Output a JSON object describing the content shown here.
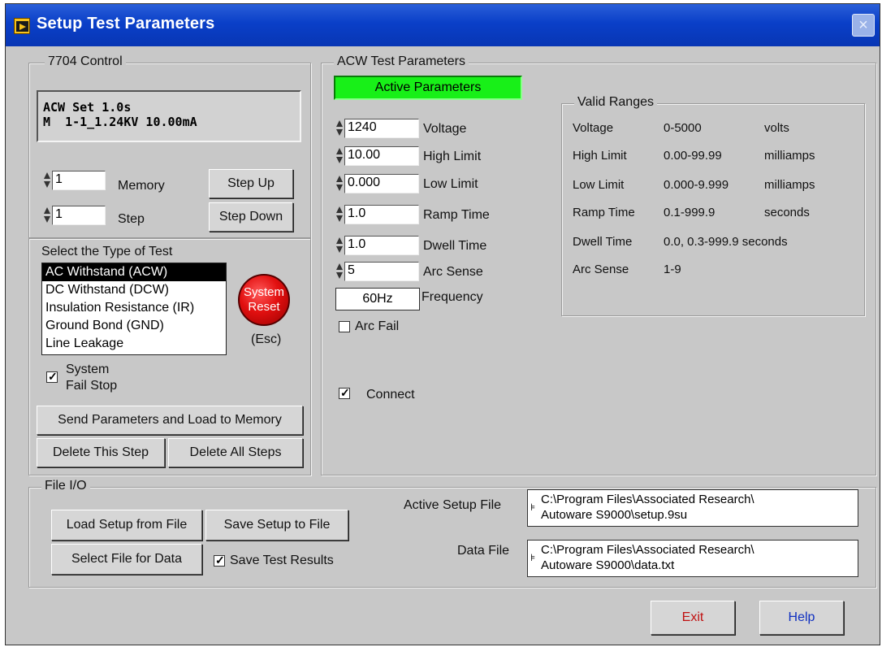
{
  "window": {
    "title": "Setup Test Parameters",
    "close_label": "×"
  },
  "control": {
    "legend": "7704 Control",
    "display_line1": "ACW Set 1.0s",
    "display_line2": "M  1-1_1.24KV 10.00mA",
    "memory_value": "1",
    "memory_label": "Memory",
    "step_value": "1",
    "step_label": "Step",
    "step_up": "Step Up",
    "step_down": "Step Down",
    "test_type_label": "Select the Type of Test",
    "test_types": [
      "AC Withstand (ACW)",
      "DC Withstand (DCW)",
      "Insulation Resistance (IR)",
      "Ground Bond (GND)",
      "Line Leakage"
    ],
    "selected_test_index": 0,
    "reset_label_1": "System",
    "reset_label_2": "Reset",
    "reset_key": "(Esc)",
    "fail_stop_line1": "System",
    "fail_stop_line2": "Fail Stop",
    "fail_stop_checked": true,
    "send_button": "Send Parameters and Load to Memory",
    "delete_step_button": "Delete This Step",
    "delete_all_button": "Delete All Steps"
  },
  "acw": {
    "legend": "ACW Test Parameters",
    "active_banner": "Active Parameters",
    "params": [
      {
        "value": "1240",
        "label": "Voltage"
      },
      {
        "value": "10.00",
        "label": "High Limit"
      },
      {
        "value": "0.000",
        "label": "Low Limit"
      },
      {
        "value": "1.0",
        "label": "Ramp Time"
      },
      {
        "value": "1.0",
        "label": "Dwell Time"
      },
      {
        "value": "5",
        "label": "Arc Sense"
      }
    ],
    "frequency_value": "60Hz",
    "frequency_label": "Frequency",
    "arc_fail_label": "Arc Fail",
    "arc_fail_checked": false,
    "connect_label": "Connect",
    "connect_checked": true
  },
  "ranges": {
    "legend": "Valid Ranges",
    "rows": [
      {
        "name": "Voltage",
        "range": "0-5000",
        "unit": "volts"
      },
      {
        "name": "High Limit",
        "range": "0.00-99.99",
        "unit": "milliamps"
      },
      {
        "name": "Low Limit",
        "range": "0.000-9.999",
        "unit": "milliamps"
      },
      {
        "name": "Ramp Time",
        "range": "0.1-999.9",
        "unit": "seconds"
      },
      {
        "name": "Dwell Time",
        "range": "0.0, 0.3-999.9 seconds",
        "unit": ""
      },
      {
        "name": "Arc Sense",
        "range": "1-9",
        "unit": ""
      }
    ]
  },
  "file_io": {
    "legend": "File I/O",
    "load_button": "Load Setup from File",
    "save_button": "Save Setup to File",
    "select_data_button": "Select File for Data",
    "save_results_label": "Save Test Results",
    "save_results_checked": true,
    "active_setup_label": "Active Setup File",
    "active_setup_path_1": "C:\\Program Files\\Associated Research\\",
    "active_setup_path_2": "Autoware S9000\\setup.9su",
    "data_file_label": "Data File",
    "data_file_path_1": "C:\\Program Files\\Associated Research\\",
    "data_file_path_2": "Autoware S9000\\data.txt"
  },
  "footer": {
    "exit": "Exit",
    "help": "Help"
  },
  "colors": {
    "title_bar": "#0a3fc8",
    "active_banner": "#18f018",
    "reset_button": "#e21010",
    "exit_text": "#c01010",
    "help_text": "#1030c0"
  }
}
